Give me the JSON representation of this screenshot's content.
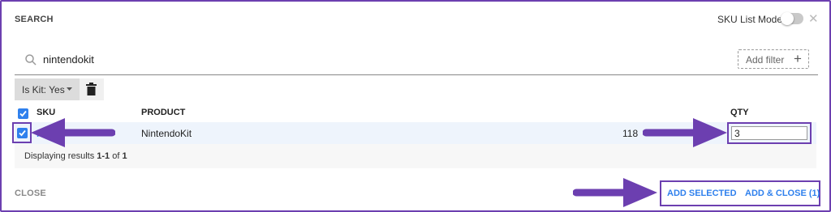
{
  "dialog": {
    "title": "SEARCH",
    "sku_list_mode_label": "SKU List Mode"
  },
  "search": {
    "value": "nintendokit",
    "add_filter_label": "Add filter",
    "add_filter_plus": "+"
  },
  "filter_chip": {
    "label": "Is Kit: Yes"
  },
  "table": {
    "headers": {
      "sku": "SKU",
      "product": "PRODUCT",
      "qty": "QTY"
    },
    "rows": [
      {
        "sku": "Ni",
        "product": "NintendoKit",
        "available": "118",
        "qty": "3",
        "selected": true
      }
    ]
  },
  "pagination": {
    "prefix": "Displaying results",
    "range": "1-1",
    "of_word": "of",
    "total": "1"
  },
  "footer": {
    "close_label": "CLOSE",
    "add_selected_label": "ADD SELECTED",
    "add_close_label": "ADD & CLOSE (1)"
  },
  "colors": {
    "accent_blue": "#2f80ed",
    "annotation_purple": "#6c3fb0"
  }
}
